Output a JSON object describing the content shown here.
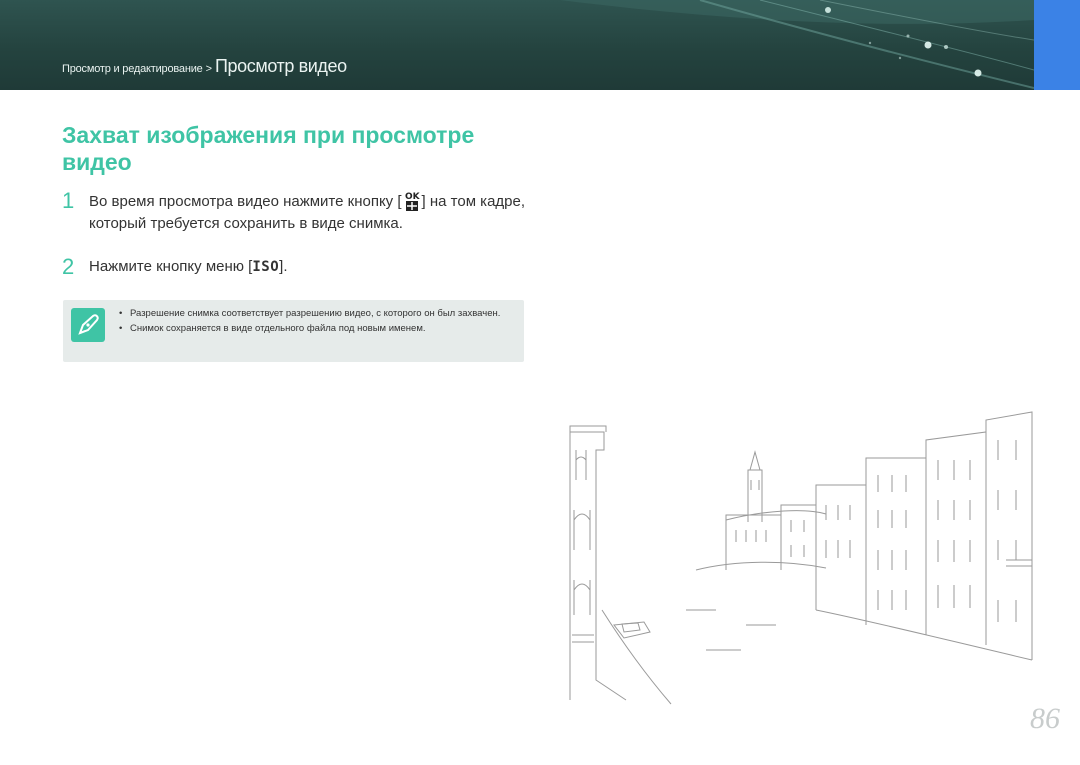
{
  "header": {
    "breadcrumb_parent": "Просмотр и редактирование",
    "breadcrumb_separator": ">",
    "breadcrumb_current": "Просмотр видео",
    "accent_color": "#3b82e6",
    "band_color": "#2a4a46"
  },
  "title": "Захват изображения при просмотре видео",
  "steps": [
    {
      "number": "1",
      "text_before_icon": "Во время просмотра видео нажмите кнопку [",
      "icon": "ok-button-icon",
      "icon_label": "OK",
      "text_after_icon": "] на том кадре, который требуется сохранить в виде снимка."
    },
    {
      "number": "2",
      "text_before_icon": "Нажмите кнопку меню [",
      "icon_label": "ISO",
      "text_after_icon": "]."
    }
  ],
  "note": {
    "icon": "pen-icon",
    "items": [
      "Разрешение снимка соответствует разрешению видео, с которого он был захвачен.",
      "Снимок сохраняется в виде отдельного файла под новым именем."
    ]
  },
  "illustration": {
    "subject": "venice-canal-sketch"
  },
  "page_number": "86",
  "colors": {
    "title": "#3fc4a5",
    "note_background": "#e6ebea",
    "page_number": "#c8cccc"
  }
}
